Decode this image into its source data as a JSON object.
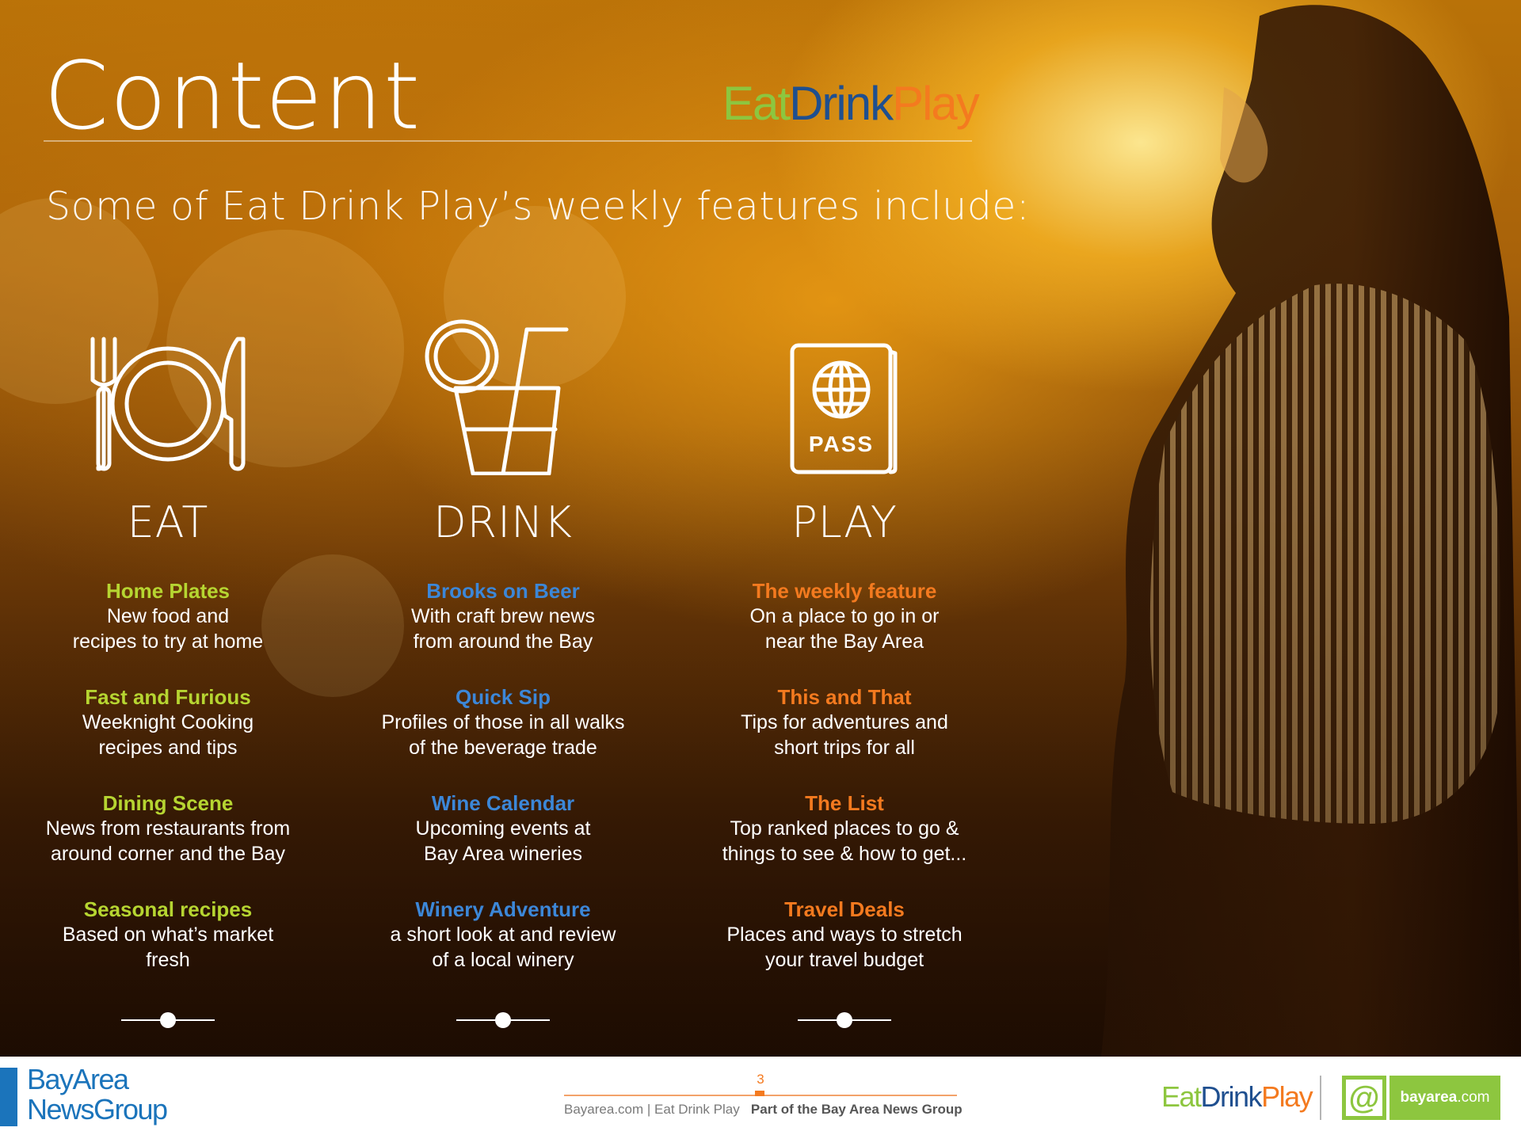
{
  "page": {
    "title": "Content",
    "subtitle": "Some of Eat Drink Play’s weekly features include:"
  },
  "brand": {
    "eat": "Eat",
    "drink": "Drink",
    "play": "Play",
    "colors": {
      "eat": "#8dc63f",
      "drink": "#1f4f8f",
      "play": "#f47a1f"
    }
  },
  "columns": [
    {
      "heading": "EAT",
      "icon": "plate-fork-knife-icon",
      "accent": "#b6d531",
      "features": [
        {
          "name": "Home Plates",
          "line1": "New food and",
          "line2": "recipes to try at home"
        },
        {
          "name": "Fast and Furious",
          "line1": "Weeknight Cooking",
          "line2": "recipes and tips"
        },
        {
          "name": "Dining Scene",
          "line1": "News from restaurants from",
          "line2": "around corner and the Bay"
        },
        {
          "name": "Seasonal recipes",
          "line1": "Based on what’s market",
          "line2": "fresh"
        }
      ]
    },
    {
      "heading": "DRINK",
      "icon": "drink-glass-icon",
      "accent": "#3c87d8",
      "features": [
        {
          "name": "Brooks on Beer",
          "line1": "With craft brew news",
          "line2": "from around the Bay"
        },
        {
          "name": "Quick Sip",
          "line1": "Profiles of those in all walks",
          "line2": "of the beverage trade"
        },
        {
          "name": "Wine Calendar",
          "line1": "Upcoming events at",
          "line2": "Bay Area wineries"
        },
        {
          "name": "Winery Adventure",
          "line1": "a short look at and review",
          "line2": "of a local winery"
        }
      ]
    },
    {
      "heading": "PLAY",
      "icon": "passport-icon",
      "icon_text": "PASS",
      "accent": "#f47a1f",
      "features": [
        {
          "name": "The weekly feature",
          "line1": "On a place to go in or",
          "line2": "near the Bay Area"
        },
        {
          "name": "This and That",
          "line1": "Tips for adventures and",
          "line2": "short trips for all"
        },
        {
          "name": "The List",
          "line1": "Top ranked places to go &",
          "line2": "things to see & how to get..."
        },
        {
          "name": "Travel Deals",
          "line1": "Places and ways to stretch",
          "line2": "your travel budget"
        }
      ]
    }
  ],
  "footer": {
    "publisher_line1": "BayArea",
    "publisher_line2": "NewsGroup",
    "page_number": "3",
    "site_text": "Bayarea.com | Eat Drink Play",
    "group_text": "Part of the Bay Area News Group",
    "brand_eat": "Eat",
    "brand_drink": "Drink",
    "brand_play": "Play",
    "logo_at": "@",
    "logo_name": "bayarea",
    "logo_domain": ".com"
  }
}
